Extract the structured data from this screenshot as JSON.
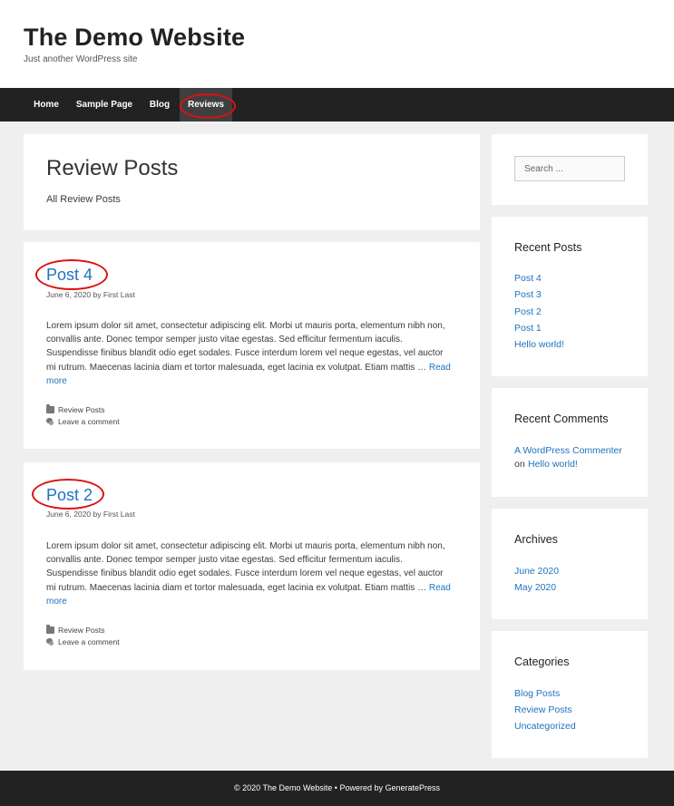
{
  "header": {
    "title": "The Demo Website",
    "description": "Just another WordPress site"
  },
  "nav": {
    "items": [
      "Home",
      "Sample Page",
      "Blog",
      "Reviews"
    ],
    "active": "Reviews"
  },
  "archive": {
    "title": "Review Posts",
    "description": "All Review Posts"
  },
  "posts": [
    {
      "title": "Post 4",
      "date": "June 6, 2020",
      "by": "by",
      "author": "First Last",
      "excerpt": "Lorem ipsum dolor sit amet, consectetur adipiscing elit. Morbi ut mauris porta, elementum nibh non, convallis ante. Donec tempor semper justo vitae egestas. Sed efficitur fermentum iaculis. Suspendisse finibus blandit odio eget sodales. Fusce interdum lorem vel neque egestas, vel auctor mi rutrum. Maecenas lacinia diam et tortor malesuada, eget lacinia ex volutpat. Etiam mattis …",
      "read_more": "Read more",
      "category": "Review Posts",
      "comments": "Leave a comment"
    },
    {
      "title": "Post 2",
      "date": "June 6, 2020",
      "by": "by",
      "author": "First Last",
      "excerpt": "Lorem ipsum dolor sit amet, consectetur adipiscing elit. Morbi ut mauris porta, elementum nibh non, convallis ante. Donec tempor semper justo vitae egestas. Sed efficitur fermentum iaculis. Suspendisse finibus blandit odio eget sodales. Fusce interdum lorem vel neque egestas, vel auctor mi rutrum. Maecenas lacinia diam et tortor malesuada, eget lacinia ex volutpat. Etiam mattis …",
      "read_more": "Read more",
      "category": "Review Posts",
      "comments": "Leave a comment"
    }
  ],
  "sidebar": {
    "search_placeholder": "Search ...",
    "recent_posts": {
      "title": "Recent Posts",
      "items": [
        "Post 4",
        "Post 3",
        "Post 2",
        "Post 1",
        "Hello world!"
      ]
    },
    "recent_comments": {
      "title": "Recent Comments",
      "commenter": "A WordPress Commenter",
      "on": "on",
      "post": "Hello world!"
    },
    "archives": {
      "title": "Archives",
      "items": [
        "June 2020",
        "May 2020"
      ]
    },
    "categories": {
      "title": "Categories",
      "items": [
        "Blog Posts",
        "Review Posts",
        "Uncategorized"
      ]
    }
  },
  "footer": {
    "text": "© 2020 The Demo Website • Powered by GeneratePress"
  },
  "colors": {
    "link": "#1e73be",
    "nav_bg": "#222222",
    "annotation": "#dd1111"
  }
}
